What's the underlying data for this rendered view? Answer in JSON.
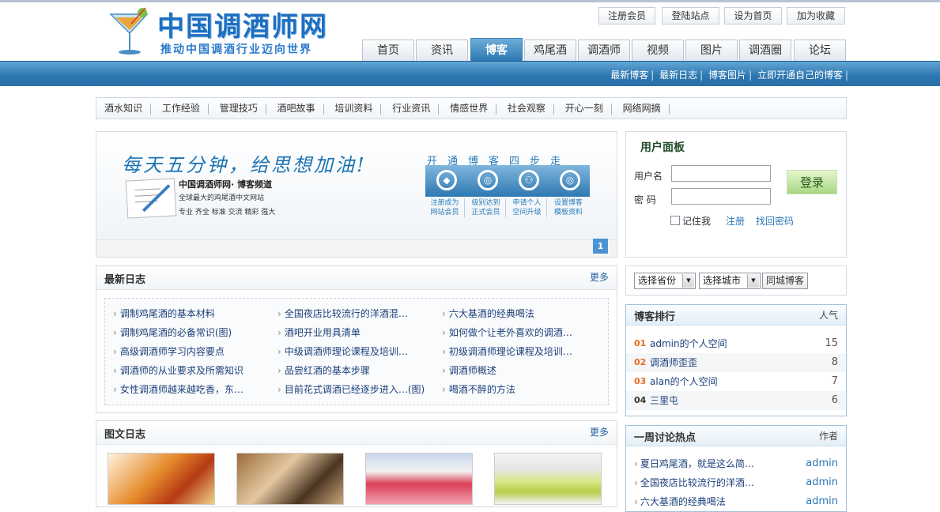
{
  "site": {
    "title": "中国调酒师网",
    "slogan": "推动中国调酒行业迈向世界"
  },
  "toplinks": [
    "注册会员",
    "登陆站点",
    "设为首页",
    "加为收藏"
  ],
  "nav": [
    {
      "label": "首页",
      "active": false
    },
    {
      "label": "资讯",
      "active": false
    },
    {
      "label": "博客",
      "active": true
    },
    {
      "label": "鸡尾酒",
      "active": false
    },
    {
      "label": "调酒师",
      "active": false
    },
    {
      "label": "视频",
      "active": false
    },
    {
      "label": "图片",
      "active": false
    },
    {
      "label": "调酒圈",
      "active": false
    },
    {
      "label": "论坛",
      "active": false
    }
  ],
  "sublinks": [
    "最新博客",
    "最新日志",
    "博客图片",
    "立即开通自己的博客"
  ],
  "categories": [
    "酒水知识",
    "工作经验",
    "管理技巧",
    "酒吧故事",
    "培训资料",
    "行业资讯",
    "情感世界",
    "社会观察",
    "开心一刻",
    "网络网摘"
  ],
  "banner": {
    "headline": "每天五分钟，给思想加油!",
    "brand": "中国调酒师网· 博客频道",
    "sub1": "全球最大的鸡尾酒中文网站",
    "sub2": "专业 齐全 标准 交流 精彩 强大",
    "steps_title": "开通博客四步走",
    "steps": [
      {
        "l1": "注册成为",
        "l2": "网站会员"
      },
      {
        "l1": "级别达到",
        "l2": "正式会员"
      },
      {
        "l1": "申请个人",
        "l2": "空间升级"
      },
      {
        "l1": "设置博客",
        "l2": "模板资料"
      }
    ],
    "page": "1"
  },
  "latest": {
    "title": "最新日志",
    "more": "更多",
    "items": [
      "调制鸡尾酒的基本材料",
      "全国夜店比较流行的洋酒混…",
      "六大基酒的经典喝法",
      "调制鸡尾酒的必备常识(图)",
      "酒吧开业用具清单",
      "如何做个让老外喜欢的调酒…",
      "高级调酒师学习内容要点",
      "中级调酒师理论课程及培训…",
      "初级调酒师理论课程及培训…",
      "调酒师的从业要求及所需知识",
      "品尝红酒的基本步骤",
      "调酒师概述",
      "女性调酒师越来越吃香，东…",
      "目前花式调酒已经逐步进入…(图)",
      "喝酒不醉的方法"
    ]
  },
  "photo": {
    "title": "图文日志",
    "more": "更多"
  },
  "user_panel": {
    "title": "用户面板",
    "username_label": "用户名",
    "password_label": "密  码",
    "username_value": "",
    "password_value": "",
    "login": "登录",
    "remember": "记住我",
    "register": "注册",
    "forgot": "找回密码"
  },
  "city": {
    "province": "选择省份",
    "city": "选择城市",
    "button": "同城博客"
  },
  "ranking": {
    "title": "博客排行",
    "col": "人气",
    "items": [
      {
        "no": "01",
        "name": "admin的个人空间",
        "value": "15"
      },
      {
        "no": "02",
        "name": "调酒师歪歪",
        "value": "8"
      },
      {
        "no": "03",
        "name": "alan的个人空间",
        "value": "7"
      },
      {
        "no": "04",
        "name": "三里屯",
        "value": "6"
      }
    ]
  },
  "hot": {
    "title": "一周讨论热点",
    "col": "作者",
    "items": [
      {
        "title": "夏日鸡尾酒，就是这么简…",
        "author": "admin"
      },
      {
        "title": "全国夜店比较流行的洋酒…",
        "author": "admin"
      },
      {
        "title": "六大基酒的经典喝法",
        "author": "admin"
      }
    ]
  },
  "colors": {
    "brand_blue": "#2b76b0",
    "rank_top": "#e96b1f",
    "rank_other": "#333333"
  }
}
